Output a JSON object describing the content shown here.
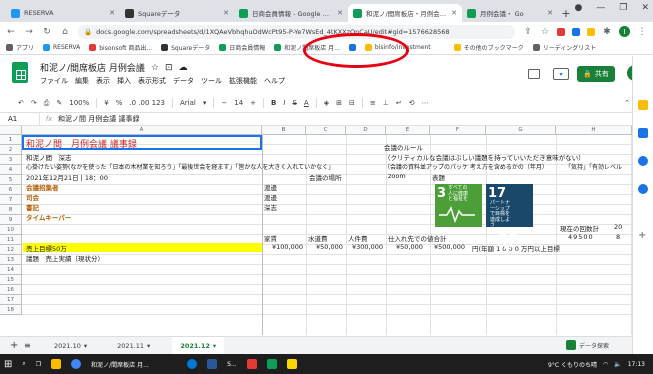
{
  "browser_tabs": [
    {
      "label": "RESERVA",
      "color": "#2196f3",
      "active": false
    },
    {
      "label": "Squareデータ",
      "color": "#333333",
      "active": false
    },
    {
      "label": "日商会員情報 - Google スプレッ",
      "color": "#0f9d58",
      "active": false
    },
    {
      "label": "和泥ノ/間席板店・月例会議・Goo",
      "color": "#0f9d58",
      "active": true
    },
    {
      "label": "月例会議・ Go",
      "color": "#0f9d58",
      "active": false
    }
  ],
  "address": {
    "url": "docs.google.com/spreadsheets/d/1XQAeVbhqhuOdWcPt95-P-Ye7WsEd_4tKXXzOnCaU/edit#gid=1576628568"
  },
  "bookmarks": [
    {
      "label": "アプリ",
      "color": "#5f6368"
    },
    {
      "label": "RESERVA",
      "color": "#2196f3"
    },
    {
      "label": "bisonsoft 商品出...",
      "color": "#e53935"
    },
    {
      "label": "Squareデータ",
      "color": "#333333"
    },
    {
      "label": "日商会員情報",
      "color": "#0f9d58"
    },
    {
      "label": "和泥ノ間席板店 月...",
      "color": "#0f9d58"
    },
    {
      "label": "",
      "color": "#1a73e8"
    },
    {
      "label": "bisinfo/investment",
      "color": "#fbbc04"
    },
    {
      "label": "その他のブックマーク",
      "color": "#fbbc04"
    },
    {
      "label": "リーディングリスト",
      "color": "#5f6368"
    }
  ],
  "doc": {
    "title": "和泥ノ/間席板店 月例会議",
    "menu": [
      "ファイル",
      "編集",
      "表示",
      "挿入",
      "表示形式",
      "データ",
      "ツール",
      "拡張機能",
      "ヘルプ"
    ],
    "share_label": "共有",
    "user_initial": "I"
  },
  "toolbar": {
    "zoom": "100%",
    "currency": "¥",
    "percent": "%",
    "decimals": ".0 .00 123",
    "font": "Arial",
    "size": "14",
    "bold": "B",
    "italic": "I",
    "strike": "S",
    "textcolor": "A"
  },
  "formula": {
    "name_box": "A1",
    "fx": "fx",
    "value": "和泥ノ間 月例会議 議事録"
  },
  "columns": [
    "A",
    "B",
    "C",
    "D",
    "E",
    "F",
    "G",
    "H"
  ],
  "rows": [
    "1",
    "2",
    "3",
    "4",
    "5",
    "6",
    "7",
    "8",
    "9",
    "10",
    "11",
    "12",
    "13",
    "14",
    "15",
    "16",
    "17",
    "18"
  ],
  "cells": {
    "a1": "和泥ノ間　月例会議 議事録",
    "a2": "和泥ノ間　深志",
    "a3": "心掛けたい姿勢(なかを使った「日本の木材業を知ろう」「最後世会を経ます」「皆かな人を大きく入れていかなく」",
    "a4": "2021年12月21日 | 18：00",
    "d4": "会議の場所",
    "e4": "zoom",
    "a5": "会議招集者",
    "a6": "司会",
    "a7": "書記",
    "a8": "タイムキーパー",
    "b5": "渡邊",
    "b6": "渡邊",
    "b7": "深志",
    "f1": "会議のルール",
    "f2": "（クリティカルな会議はぶしい議題を持っていいただき意味がない）",
    "f3": "（会議の資料並アップのパッケ 考え方を含めるかの（年月）",
    "h3": "「気持」「有効レベル",
    "f4": "表題",
    "b9": "家賃",
    "c9": "水道費",
    "d9": "人件費",
    "e9": "仕入れ先での値合計",
    "h8": "現在の回数計",
    "i8": "20",
    "h9": "49500",
    "i9": "8",
    "b10": "¥100,000",
    "c10": "¥50,000",
    "d10": "¥300,000",
    "e10": "¥50,000",
    "f10": "¥500,000",
    "g10": "円(年額 1 0 0 0 万円以上目標",
    "a10": "売上目標50万",
    "a11": "議題　売上実績（現状分）"
  },
  "sdg": [
    {
      "num": "3",
      "text": "すべての人に健康と福祉を",
      "color": "#4c9f38"
    },
    {
      "num": "17",
      "text": "パートナーシップで目標を達成しよう",
      "color": "#19486a"
    }
  ],
  "sheet_tabs": [
    "2021.10",
    "2021.11",
    "2021.12"
  ],
  "active_sheet": "2021.12",
  "explore_label": "データ探索",
  "taskbar": {
    "search": "ここに入力して検索",
    "app1": "和泥ノ/間席板店 月...",
    "app2": "S...",
    "weather": "9°C くもりのち晴",
    "time": "17:13"
  },
  "annotation_color": "#e60012"
}
